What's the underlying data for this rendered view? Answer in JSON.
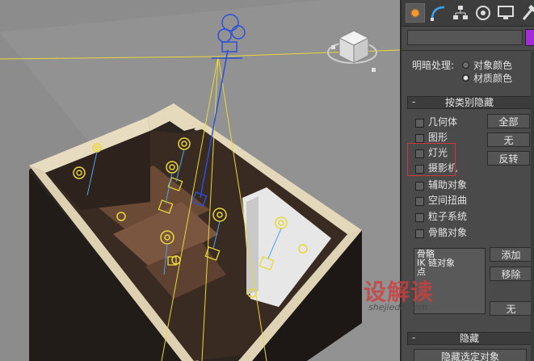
{
  "command_panel": {
    "tabs": [
      {
        "name": "create",
        "icon": "sun-icon"
      },
      {
        "name": "modify",
        "icon": "arc-icon"
      },
      {
        "name": "hierarchy",
        "icon": "hierarchy-icon"
      },
      {
        "name": "motion",
        "icon": "motion-icon"
      },
      {
        "name": "display",
        "icon": "monitor-icon"
      },
      {
        "name": "utilities",
        "icon": "hammer-icon"
      }
    ],
    "object_color_hex": "#a42bd8"
  },
  "display_color": {
    "label": "明暗处理:",
    "options": [
      "对象颜色",
      "材质颜色"
    ],
    "selected": "材质颜色"
  },
  "hide_by_category": {
    "sign": "-",
    "title": "按类别隐藏",
    "categories": [
      "几何体",
      "图形",
      "灯光",
      "摄影机",
      "辅助对象",
      "空间扭曲",
      "粒子系统",
      "骨骼对象"
    ],
    "buttons": {
      "all": "全部",
      "none": "无",
      "invert": "反转"
    },
    "list": [
      "骨骼",
      "IK 链对象",
      "点"
    ],
    "list_buttons": {
      "add": "添加",
      "remove": "移除",
      "none": "无"
    },
    "highlight_color": "#d03838"
  },
  "hide_rollout": {
    "sign": "-",
    "title": "隐藏",
    "hide_selected": "隐藏选定对象"
  },
  "watermark": {
    "text": "设解读",
    "sub": "shejiedu.com"
  }
}
